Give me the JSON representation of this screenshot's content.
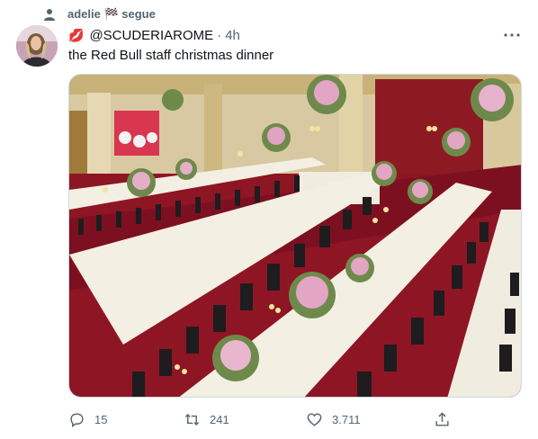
{
  "social_context": {
    "text": "adelie 🏁 segue"
  },
  "tweet": {
    "emoji": "💋",
    "handle": "@SCUDERIAROME",
    "separator": "·",
    "time": "4h",
    "text": "the Red Bull staff christmas dinner"
  },
  "media": {
    "description": "photo-banquet-hall"
  },
  "actions": {
    "reply_count": "15",
    "retweet_count": "241",
    "like_count": "3.711"
  },
  "colors": {
    "secondary_text": "#536471",
    "border": "#cfd9de",
    "carpet_red": "#8e1524",
    "tablecloth": "#f3efe2"
  }
}
